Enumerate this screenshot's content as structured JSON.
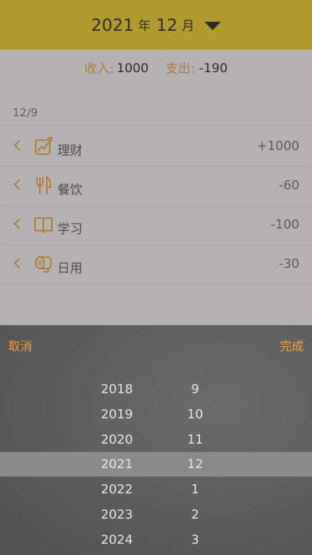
{
  "header": {
    "year": "2021",
    "year_unit": "年",
    "month": "12",
    "month_unit": "月"
  },
  "summary": {
    "income_label": "收入:",
    "income_value": "1000",
    "expense_label": "支出:",
    "expense_value": "-190"
  },
  "date_group": "12/9",
  "items": [
    {
      "icon": "finance-chart-icon",
      "name": "理财",
      "amount": "+1000"
    },
    {
      "icon": "fork-knife-icon",
      "name": "餐饮",
      "amount": "-60"
    },
    {
      "icon": "book-icon",
      "name": "学习",
      "amount": "-100"
    },
    {
      "icon": "tissue-roll-icon",
      "name": "日用",
      "amount": "-30"
    }
  ],
  "picker": {
    "cancel_label": "取消",
    "done_label": "完成",
    "years": [
      "2018",
      "2019",
      "2020",
      "2021",
      "2022",
      "2023",
      "2024"
    ],
    "months": [
      "9",
      "10",
      "11",
      "12",
      "1",
      "2",
      "3"
    ],
    "selected_year": "2021",
    "selected_month": "12"
  },
  "colors": {
    "header_bg": "#b29a2d",
    "accent": "#b07a30",
    "picker_action": "#f0a03a"
  }
}
